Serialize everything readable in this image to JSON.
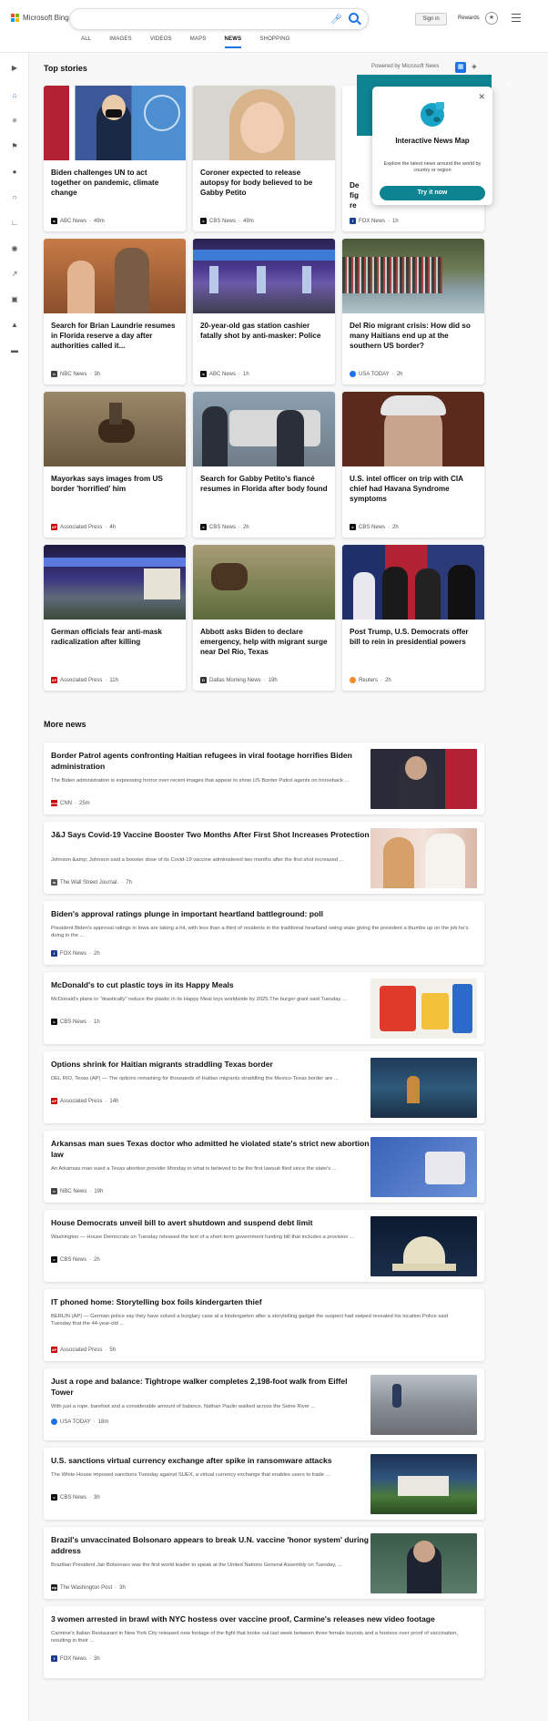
{
  "header": {
    "logo_text": "Microsoft Bing",
    "signin_label": "Sign in",
    "rewards_label": "Rewards",
    "tabs": [
      "ALL",
      "IMAGES",
      "VIDEOS",
      "MAPS",
      "NEWS",
      "SHOPPING"
    ],
    "active_tab": "NEWS"
  },
  "top_stories": {
    "heading": "Top stories",
    "powered_by": "Powered by Microsoft News",
    "cards": [
      {
        "title": "Biden challenges UN to act together on pandemic, climate change",
        "source": "ABC News",
        "age": "49m"
      },
      {
        "title": "Coroner expected to release autopsy for body believed to be Gabby Petito",
        "source": "CBS News",
        "age": "49m"
      },
      {
        "title": "De... fig... re...",
        "source": "FOX News",
        "age": "1h"
      },
      {
        "title": "Search for Brian Laundrie resumes in Florida reserve a day after authorities called it...",
        "source": "NBC News",
        "age": "3h"
      },
      {
        "title": "20-year-old gas station cashier fatally shot by anti-masker: Police",
        "source": "ABC News",
        "age": "1h"
      },
      {
        "title": "Del Rio migrant crisis: How did so many Haitians end up at the southern US border?",
        "source": "USA TODAY",
        "age": "2h"
      },
      {
        "title": "Mayorkas says images from US border 'horrified' him",
        "source": "Associated Press",
        "age": "4h"
      },
      {
        "title": "Search for Gabby Petito's fiancé resumes in Florida after body found",
        "source": "CBS News",
        "age": "2h"
      },
      {
        "title": "U.S. intel officer on trip with CIA chief had Havana Syndrome symptoms",
        "source": "CBS News",
        "age": "2h"
      },
      {
        "title": "German officials fear anti-mask radicalization after killing",
        "source": "Associated Press",
        "age": "11h"
      },
      {
        "title": "Abbott asks Biden to declare emergency, help with migrant surge near Del Rio, Texas",
        "source": "Dallas Morning News",
        "age": "19h"
      },
      {
        "title": "Post Trump, U.S. Democrats offer bill to rein in presidential powers",
        "source": "Reuters",
        "age": "2h"
      }
    ]
  },
  "popup": {
    "title": "Interactive News Map",
    "description": "Explore the latest news around the world by country or region",
    "button": "Try it now"
  },
  "more_news": {
    "heading": "More news",
    "items": [
      {
        "title": "Border Patrol agents confronting Haitian refugees in viral footage horrifies Biden administration",
        "desc": "The Biden administration is expressing horror over recent images that appear to show US Border Patrol agents on horseback ...",
        "source": "CNN",
        "age": "25m"
      },
      {
        "title": "J&J Says Covid-19 Vaccine Booster Two Months After First Shot Increases Protection",
        "desc": "Johnson &amp; Johnson said a booster dose of its Covid-19 vaccine administered two months after the first shot increased ...",
        "source": "The Wall Street Journal.",
        "age": "7h"
      },
      {
        "title": "Biden's approval ratings plunge in important heartland battleground: poll",
        "desc": "President Biden's approval ratings in Iowa are taking a hit, with less than a third of residents in the traditional heartland swing state giving the president a thumbs up on the job he's doing in the ...",
        "source": "FOX News",
        "age": "2h"
      },
      {
        "title": "McDonald's to cut plastic toys in its Happy Meals",
        "desc": "McDonald's plans to \"drastically\" reduce the plastic in its Happy Meal toys worldwide by 2025.The burger giant said Tuesday ...",
        "source": "CBS News",
        "age": "1h"
      },
      {
        "title": "Options shrink for Haitian migrants straddling Texas border",
        "desc": "DEL RIO, Texas (AP) — The options remaining for thousands of Haitian migrants straddling the Mexico-Texas border are ...",
        "source": "Associated Press",
        "age": "14h"
      },
      {
        "title": "Arkansas man sues Texas doctor who admitted he violated state's strict new abortion law",
        "desc": "An Arkansas man sued a Texas abortion provider Monday in what is believed to be the first lawsuit filed since the state's ...",
        "source": "NBC News",
        "age": "19h"
      },
      {
        "title": "House Democrats unveil bill to avert shutdown and suspend debt limit",
        "desc": "Washington — House Democrats on Tuesday released the text of a short-term government funding bill that includes a provision ...",
        "source": "CBS News",
        "age": "2h"
      },
      {
        "title": "IT phoned home: Storytelling box foils kindergarten thief",
        "desc": "BERLIN (AP) — German police say they have solved a burglary case at a kindergarten after a storytelling gadget the suspect had swiped revealed his location.Police said Tuesday that the 44-year-old ...",
        "source": "Associated Press",
        "age": "5h"
      },
      {
        "title": "Just a rope and balance: Tightrope walker completes 2,198-foot walk from Eiffel Tower",
        "desc": "With just a rope, barefoot and a considerable amount of balance, Nathan Paulin walked across the Seine River ...",
        "source": "USA TODAY",
        "age": "18m"
      },
      {
        "title": "U.S. sanctions virtual currency exchange after spike in ransomware attacks",
        "desc": "The White House imposed sanctions Tuesday against SUEX, a virtual currency exchange that enables users to trade ...",
        "source": "CBS News",
        "age": "3h"
      },
      {
        "title": "Brazil's unvaccinated Bolsonaro appears to break U.N. vaccine 'honor system' during address",
        "desc": "Brazilian President Jair Bolsonaro was the first world leader to speak at the United Nations General Assembly on Tuesday, ...",
        "source": "The Washington Post",
        "age": "3h"
      },
      {
        "title": "3 women arrested in brawl with NYC hostess over vaccine proof, Carmine's releases new video footage",
        "desc": "Carmine's Italian Restaurant in New York City released new footage of the fight that broke out last week between three female tourists and a hostess over proof of vaccination, resulting in their ...",
        "source": "FOX News",
        "age": "3h"
      }
    ]
  },
  "colors": {
    "accent": "#1a73e8",
    "teal": "#0e8493"
  }
}
